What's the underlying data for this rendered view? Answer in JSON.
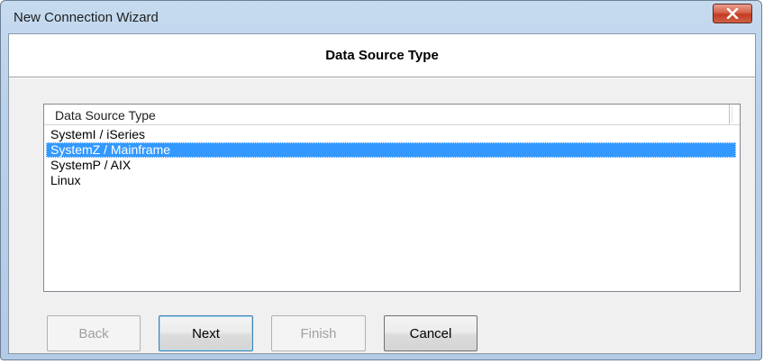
{
  "window": {
    "title": "New Connection Wizard",
    "close_icon": "close-x-icon"
  },
  "header": {
    "title": "Data Source Type"
  },
  "list": {
    "column_header": "Data Source Type",
    "items": [
      "SystemI / iSeries",
      "SystemZ / Mainframe",
      "SystemP / AIX",
      "Linux"
    ],
    "selected": "SystemZ / Mainframe"
  },
  "buttons": {
    "back": "Back",
    "next": "Next",
    "finish": "Finish",
    "cancel": "Cancel"
  },
  "colors": {
    "selection": "#3399ff",
    "close_button": "#c33b22",
    "titlebar": "#b9d1ea"
  }
}
